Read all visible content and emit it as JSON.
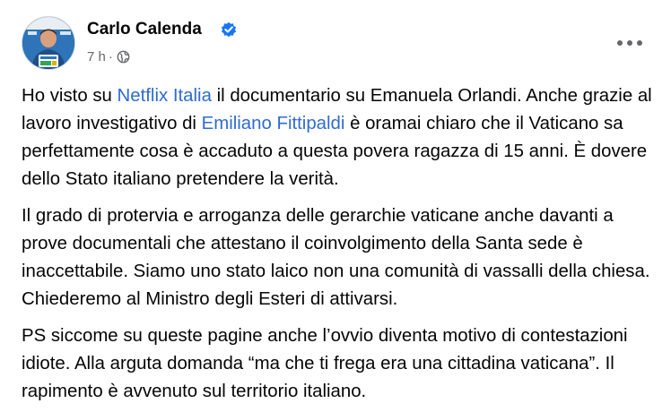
{
  "post": {
    "author": "Carlo Calenda",
    "verified": true,
    "time": "7 h",
    "separator": "·",
    "privacy_icon": "globe-icon",
    "more_icon": "more-horizontal-icon",
    "paragraphs": [
      {
        "segments": [
          {
            "text": "Ho visto su ",
            "link": false
          },
          {
            "text": "Netflix Italia",
            "link": true
          },
          {
            "text": " il documentario su Emanuela Orlandi. Anche grazie al lavoro investigativo di ",
            "link": false
          },
          {
            "text": "Emiliano Fittipaldi",
            "link": true
          },
          {
            "text": " è oramai chiaro che il Vaticano sa perfettamente cosa è accaduto a questa povera ragazza di 15 anni. È dovere dello Stato italiano pretendere la verità.",
            "link": false
          }
        ]
      },
      {
        "segments": [
          {
            "text": "Il grado di protervia e arroganza delle gerarchie vaticane anche davanti a prove documentali che attestano il coinvolgimento della Santa sede è inaccettabile. Siamo uno stato laico non una comunità di vassalli della chiesa. Chiederemo al Ministro degli Esteri di attivarsi.",
            "link": false
          }
        ]
      },
      {
        "segments": [
          {
            "text": "PS siccome su queste pagine anche l’ovvio diventa motivo di contestazioni idiote. Alla arguta domanda “ma che ti frega era una cittadina vaticana”. Il rapimento è avvenuto sul territorio italiano.",
            "link": false
          }
        ]
      }
    ]
  },
  "colors": {
    "link": "#2f6bd0",
    "verified_badge": "#1877f2",
    "meta_text": "#65676b",
    "text": "#050505"
  }
}
